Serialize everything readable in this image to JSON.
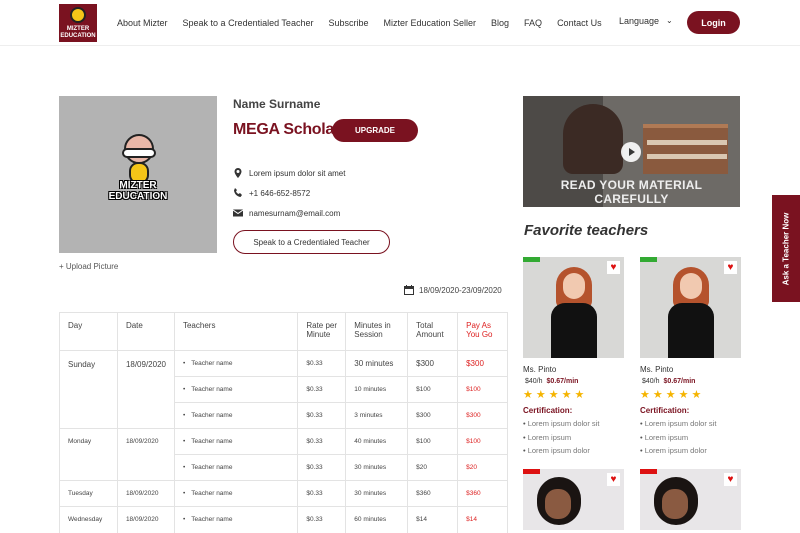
{
  "nav": {
    "logo_text": "MIZTER EDUCATION",
    "links": [
      "About Mizter",
      "Speak to a Credentialed Teacher",
      "Subscribe",
      "Mizter Education Seller",
      "Blog",
      "FAQ",
      "Contact Us"
    ],
    "language": "Language",
    "login": "Login"
  },
  "profile": {
    "avatar_text": "MIZTER EDUCATION",
    "upload": "+ Upload Picture",
    "name": "Name Surname",
    "plan": "MEGA Scholar",
    "upgrade": "UPGRADE",
    "address": "Lorem ipsum dolor sit amet",
    "phone": "+1 646-652-8572",
    "email": "namesurnam@email.com",
    "speak": "Speak to a Credentialed Teacher",
    "date_range": "18/09/2020-23/09/2020"
  },
  "table": {
    "headers": [
      "Day",
      "Date",
      "Teachers",
      "Rate per Minute",
      "Minutes in Session",
      "Total Amount",
      "Pay As You Go"
    ],
    "groups": [
      {
        "day": "Sunday",
        "date": "18/09/2020",
        "rows": [
          {
            "teacher": "Teacher name",
            "rate": "$0.33",
            "minutes": "30 minutes",
            "total": "$300",
            "payg": "$300"
          },
          {
            "teacher": "Teacher name",
            "rate": "$0.33",
            "minutes": "10 minutes",
            "total": "$100",
            "payg": "$100"
          },
          {
            "teacher": "Teacher name",
            "rate": "$0.33",
            "minutes": "3 minutes",
            "total": "$300",
            "payg": "$300"
          }
        ]
      },
      {
        "day": "Monday",
        "date": "18/09/2020",
        "rows": [
          {
            "teacher": "Teacher name",
            "rate": "$0.33",
            "minutes": "40 minutes",
            "total": "$100",
            "payg": "$100"
          },
          {
            "teacher": "Teacher name",
            "rate": "$0.33",
            "minutes": "30 minutes",
            "total": "$20",
            "payg": "$20"
          }
        ]
      },
      {
        "day": "Tuesday",
        "date": "18/09/2020",
        "rows": [
          {
            "teacher": "Teacher name",
            "rate": "$0.33",
            "minutes": "30 minutes",
            "total": "$360",
            "payg": "$360"
          }
        ]
      },
      {
        "day": "Wednesday",
        "date": "18/09/2020",
        "rows": [
          {
            "teacher": "Teacher name",
            "rate": "$0.33",
            "minutes": "60 minutes",
            "total": "$14",
            "payg": "$14"
          }
        ]
      }
    ]
  },
  "video": {
    "caption": "READ YOUR MATERIAL CAREFULLY"
  },
  "favorites": {
    "title": "Favorite teachers",
    "teachers": [
      {
        "name": "Ms. Pinto",
        "rate_hour": "$40/h",
        "rate_min": "$0.67/min",
        "stars": "★★★★★",
        "cert_label": "Certification:",
        "certs": [
          "Lorem ipsum dolor sit",
          "Lorem ipsum",
          "Lorem ipsum dolor"
        ]
      },
      {
        "name": "Ms. Pinto",
        "rate_hour": "$40/h",
        "rate_min": "$0.67/min",
        "stars": "★★★★★",
        "cert_label": "Certification:",
        "certs": [
          "Lorem ipsum dolor sit",
          "Lorem ipsum",
          "Lorem ipsum dolor"
        ]
      }
    ]
  },
  "side_tab": "Ask a Teacher Now",
  "colors": {
    "brand": "#7a1220",
    "star": "#f5b400",
    "pay": "#dd2222"
  }
}
